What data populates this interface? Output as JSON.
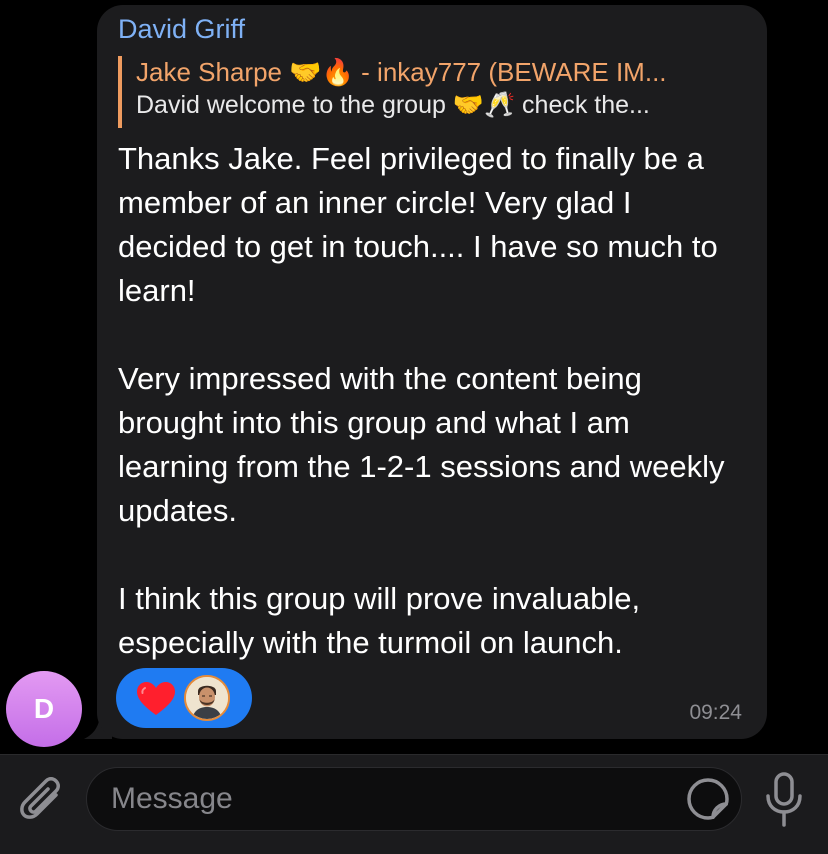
{
  "message": {
    "sender": "David Griff",
    "reply": {
      "author": "Jake Sharpe 🤝🔥 - inkay777 (BEWARE IM...",
      "text": "David welcome to the group 🤝🥂 check the..."
    },
    "paragraphs": [
      "Thanks Jake. Feel privileged to finally be a member of an inner circle! Very glad I decided to get in touch.... I have so much to learn!",
      "Very impressed with the content being brought into this group and what I am learning from the 1-2-1 sessions and weekly updates.",
      "I think this group will prove invaluable, especially with the turmoil  on launch."
    ],
    "reactions": {
      "emoji_icon": "heart-icon",
      "reactor": "reactor-avatar"
    },
    "time": "09:24",
    "avatar_initial": "D"
  },
  "composer": {
    "placeholder": "Message",
    "attach_icon": "paperclip-icon",
    "sticker_icon": "sticker-icon",
    "mic_icon": "microphone-icon"
  },
  "colors": {
    "background": "#000000",
    "bubble": "#1c1c1e",
    "sender": "#7fb1f5",
    "reply_accent": "#ef9b5f",
    "reaction_pill": "#1f7bf2",
    "avatar": "#d17fef",
    "timestamp": "#8e8e93"
  }
}
